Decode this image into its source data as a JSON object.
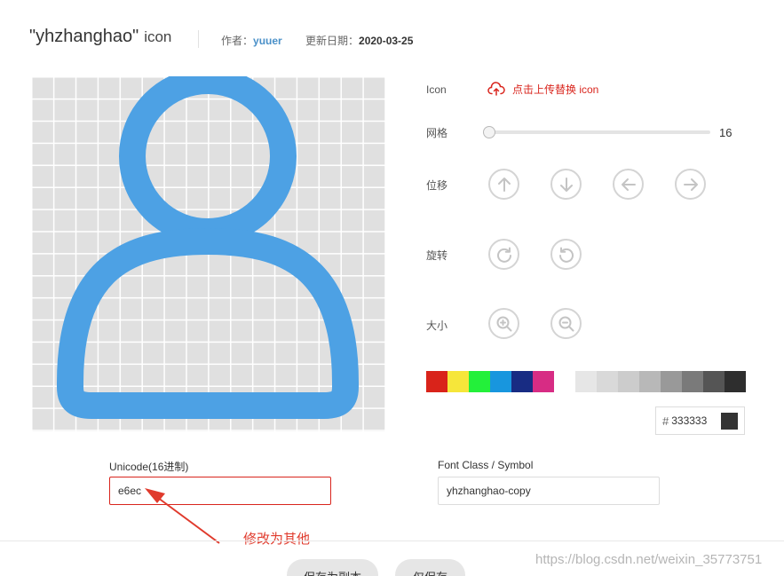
{
  "header": {
    "icon_name": "\"yhzhanghao\"",
    "icon_word": "icon",
    "author_label": "作者：",
    "author": "yuuer",
    "updated_label": "更新日期：",
    "updated_date": "2020-03-25"
  },
  "preview": {
    "icon_name": "user-outline-icon",
    "grid_size": 16,
    "icon_color": "#4da1e4"
  },
  "panel": {
    "icon_label": "Icon",
    "upload_label": "点击上传替换 icon",
    "grid_label": "网格",
    "grid_value": "16",
    "grid_value_number": 16,
    "move_label": "位移",
    "rotate_label": "旋转",
    "size_label": "大小",
    "move_buttons": [
      "arrow-up-icon",
      "arrow-down-icon",
      "arrow-left-icon",
      "arrow-right-icon"
    ],
    "rotate_buttons": [
      "rotate-clockwise-icon",
      "rotate-counterclockwise-icon"
    ],
    "size_buttons": [
      "zoom-in-icon",
      "zoom-out-icon"
    ]
  },
  "palette": [
    "#d9231a",
    "#f6e63a",
    "#23f03a",
    "#1896de",
    "#182c83",
    "#d72c84",
    "#ffffff",
    "#e6e6e6",
    "#d9d9d9",
    "#cccccc",
    "#b8b8b8",
    "#999999",
    "#7a7a7a",
    "#555555",
    "#2e2e2e"
  ],
  "color_field": {
    "hash": "#",
    "value": "333333",
    "swatch": "#333333"
  },
  "unicode": {
    "label": "Unicode(16进制)",
    "value": "e6ec"
  },
  "font_class": {
    "label": "Font Class / Symbol",
    "value": "yhzhanghao-copy"
  },
  "annotation": "修改为其他",
  "footer": {
    "save_copy": "保存为副本",
    "save_only": "仅保存"
  },
  "watermark": "https://blog.csdn.net/weixin_35773751"
}
